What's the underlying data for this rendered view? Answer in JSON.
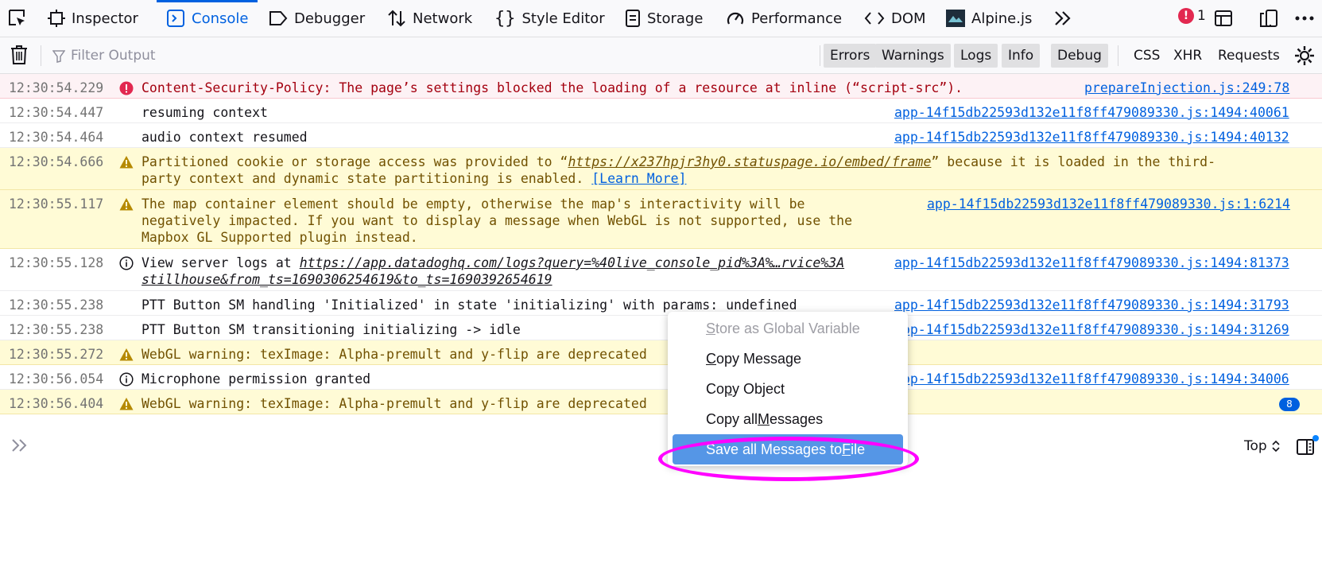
{
  "tabs": [
    {
      "label": "Inspector",
      "icon": "inspector-icon"
    },
    {
      "label": "Console",
      "icon": "console-icon",
      "selected": true
    },
    {
      "label": "Debugger",
      "icon": "debugger-icon"
    },
    {
      "label": "Network",
      "icon": "network-icon"
    },
    {
      "label": "Style Editor",
      "icon": "style-editor-icon"
    },
    {
      "label": "Storage",
      "icon": "storage-icon"
    },
    {
      "label": "Performance",
      "icon": "performance-icon"
    },
    {
      "label": "DOM",
      "icon": "dom-icon"
    },
    {
      "label": "Alpine.js",
      "icon": "alpine-icon"
    }
  ],
  "toolbar": {
    "error_count": "1"
  },
  "filter": {
    "placeholder": "Filter Output",
    "level_buttons": [
      "Errors",
      "Warnings",
      "Logs",
      "Info",
      "Debug"
    ],
    "request_buttons": [
      "CSS",
      "XHR",
      "Requests"
    ]
  },
  "messages": [
    {
      "time": "12:30:54.229",
      "level": "error",
      "text": "Content-Security-Policy: The page’s settings blocked the loading of a resource at inline (“script-src”).",
      "source": "prepareInjection.js:249:78"
    },
    {
      "time": "12:30:54.447",
      "level": "log",
      "text": "resuming context",
      "source": "app-14f15db22593d132e11f8ff479089330.js:1494:40061"
    },
    {
      "time": "12:30:54.464",
      "level": "log",
      "text": "audio context resumed",
      "source": "app-14f15db22593d132e11f8ff479089330.js:1494:40132"
    },
    {
      "time": "12:30:54.666",
      "level": "warn",
      "text_before": "Partitioned cookie or storage access was provided to “",
      "url": "https://x237hpjr3hy0.statuspage.io/embed/frame",
      "text_after_1": "” because it is loaded in the third-",
      "text_after_2": "party context and dynamic state partitioning is enabled. ",
      "link": "[Learn More]"
    },
    {
      "time": "12:30:55.117",
      "level": "warn",
      "lines": [
        "The map container element should be empty, otherwise the map's interactivity will be",
        "negatively impacted. If you want to display a message when WebGL is not supported, use the",
        "Mapbox GL Supported plugin instead."
      ],
      "source": "app-14f15db22593d132e11f8ff479089330.js:1:6214"
    },
    {
      "time": "12:30:55.128",
      "level": "info",
      "text_before": "View server logs at ",
      "url_line1": "https://app.datadoghq.com/logs?query=%40live_console_pid%3A%…rvice%3A",
      "url_line2": "stillhouse&from_ts=1690306254619&to_ts=1690392654619",
      "source": "app-14f15db22593d132e11f8ff479089330.js:1494:81373"
    },
    {
      "time": "12:30:55.238",
      "level": "log",
      "text": "PTT Button SM handling 'Initialized' in state 'initializing' with params: undefined",
      "source": "app-14f15db22593d132e11f8ff479089330.js:1494:31793"
    },
    {
      "time": "12:30:55.238",
      "level": "log",
      "text": "PTT Button SM transitioning initializing -> idle",
      "source": "app-14f15db22593d132e11f8ff479089330.js:1494:31269"
    },
    {
      "time": "12:30:55.272",
      "level": "warn",
      "text": "WebGL warning: texImage: Alpha-premult and y-flip are deprecated"
    },
    {
      "time": "12:30:56.054",
      "level": "info",
      "text": "Microphone permission granted",
      "source": "app-14f15db22593d132e11f8ff479089330.js:1494:34006"
    },
    {
      "time": "12:30:56.404",
      "level": "warn",
      "text": "WebGL warning: texImage: Alpha-premult and y-flip are deprecated",
      "repeat_count": "8"
    }
  ],
  "input": {
    "context_selector": "Top"
  },
  "context_menu": {
    "items": [
      {
        "pre": "",
        "key": "S",
        "post": "tore as Global Variable",
        "state": "disabled"
      },
      {
        "pre": "",
        "key": "C",
        "post": "opy Message",
        "state": "normal"
      },
      {
        "pre": "Co",
        "key": "p",
        "post": "y Object",
        "state": "normal"
      },
      {
        "pre": "Copy all ",
        "key": "M",
        "post": "essages",
        "state": "normal"
      },
      {
        "pre": "Save all Messages to ",
        "key": "F",
        "post": "ile",
        "state": "active"
      }
    ]
  },
  "colors": {
    "accent": "#0061e0",
    "error_bg": "#fdf2f5",
    "warn_bg": "#fffbd6",
    "menu_highlight": "#5596e6",
    "annotation_ring": "#ff00ff"
  }
}
